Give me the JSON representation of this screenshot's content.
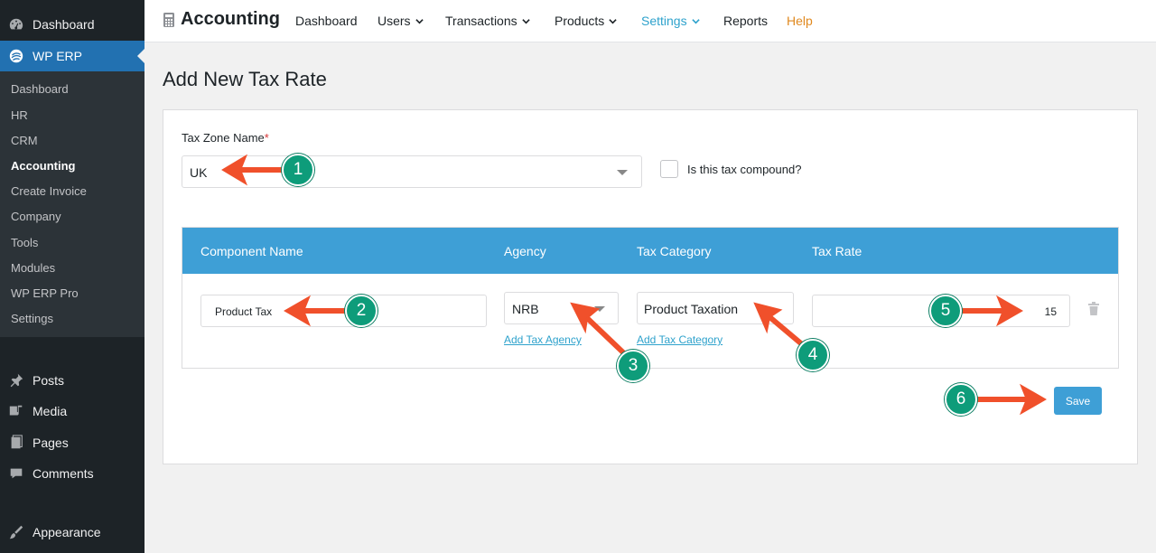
{
  "sidebar": {
    "top_items": [
      {
        "label": "Dashboard",
        "icon": "dashboard-icon"
      },
      {
        "label": "WP ERP",
        "icon": "erp-icon"
      }
    ],
    "submenu": [
      "Dashboard",
      "HR",
      "CRM",
      "Accounting",
      "Create Invoice",
      "Company",
      "Tools",
      "Modules",
      "WP ERP Pro",
      "Settings"
    ],
    "submenu_current": "Accounting",
    "bottom_items": [
      {
        "label": "Posts",
        "icon": "pin-icon"
      },
      {
        "label": "Media",
        "icon": "media-icon"
      },
      {
        "label": "Pages",
        "icon": "pages-icon"
      },
      {
        "label": "Comments",
        "icon": "comments-icon"
      },
      {
        "label": "Appearance",
        "icon": "brush-icon"
      }
    ]
  },
  "topnav": {
    "title": "Accounting",
    "items": [
      {
        "label": "Dashboard",
        "dropdown": false
      },
      {
        "label": "Users",
        "dropdown": true
      },
      {
        "label": "Transactions",
        "dropdown": true
      },
      {
        "label": "Products",
        "dropdown": true
      },
      {
        "label": "Settings",
        "dropdown": true
      },
      {
        "label": "Reports",
        "dropdown": false
      },
      {
        "label": "Help",
        "dropdown": false
      }
    ]
  },
  "page": {
    "title": "Add New Tax Rate"
  },
  "form": {
    "tax_zone_label": "Tax Zone Name",
    "tax_zone_required_mark": "*",
    "tax_zone_value": "UK",
    "compound_label": "Is this tax compound?",
    "compound_checked": false
  },
  "table": {
    "headers": [
      "Component Name",
      "Agency",
      "Tax Category",
      "Tax Rate"
    ],
    "row": {
      "component_name": "Product Tax",
      "agency": "NRB",
      "tax_category": "Product Taxation",
      "tax_rate": "15"
    },
    "add_agency_link": "Add Tax Agency",
    "add_category_link": "Add Tax Category"
  },
  "actions": {
    "save_label": "Save"
  },
  "annotations": [
    "1",
    "2",
    "3",
    "4",
    "5",
    "6"
  ],
  "colors": {
    "sidebar_bg": "#1d2327",
    "wp_active": "#2271b1",
    "table_header": "#3e9fd6",
    "link": "#2ea2cc",
    "help": "#e0891f",
    "badge": "#0e9c7a",
    "arrow": "#f0502b"
  }
}
